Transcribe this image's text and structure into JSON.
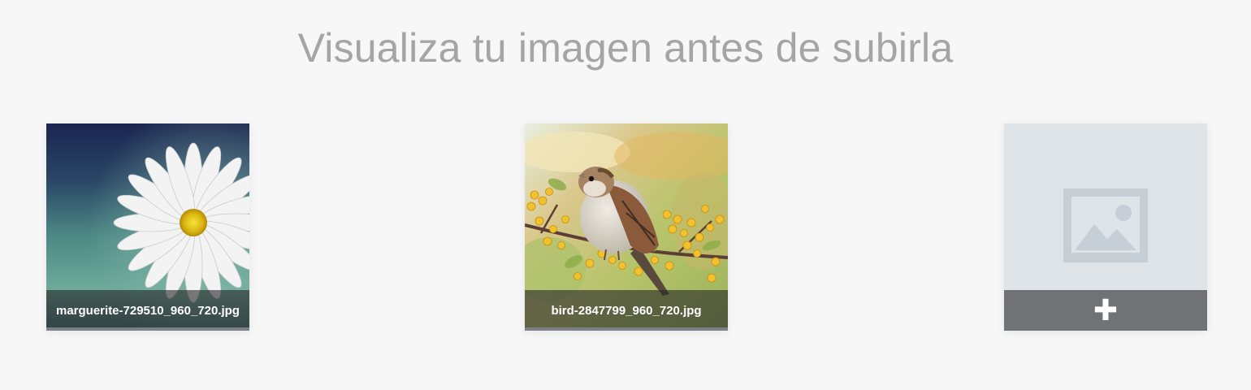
{
  "header": {
    "title": "Visualiza tu imagen antes de subirla"
  },
  "previews": [
    {
      "filename": "marguerite-729510_960_720.jpg",
      "image_subject": "white daisy flower on blue-green background"
    },
    {
      "filename": "bird-2847799_960_720.jpg",
      "image_subject": "sparrow perched on branch with yellow berries"
    }
  ],
  "upload_slot": {
    "add_symbol": "✚",
    "icon": "image-placeholder-icon"
  },
  "colors": {
    "background": "#f7f7f7",
    "title": "#a5a5a5",
    "placeholder": "#dfe4e9",
    "placeholder_icon": "#c7cfd6",
    "add_bar": "#707275"
  }
}
